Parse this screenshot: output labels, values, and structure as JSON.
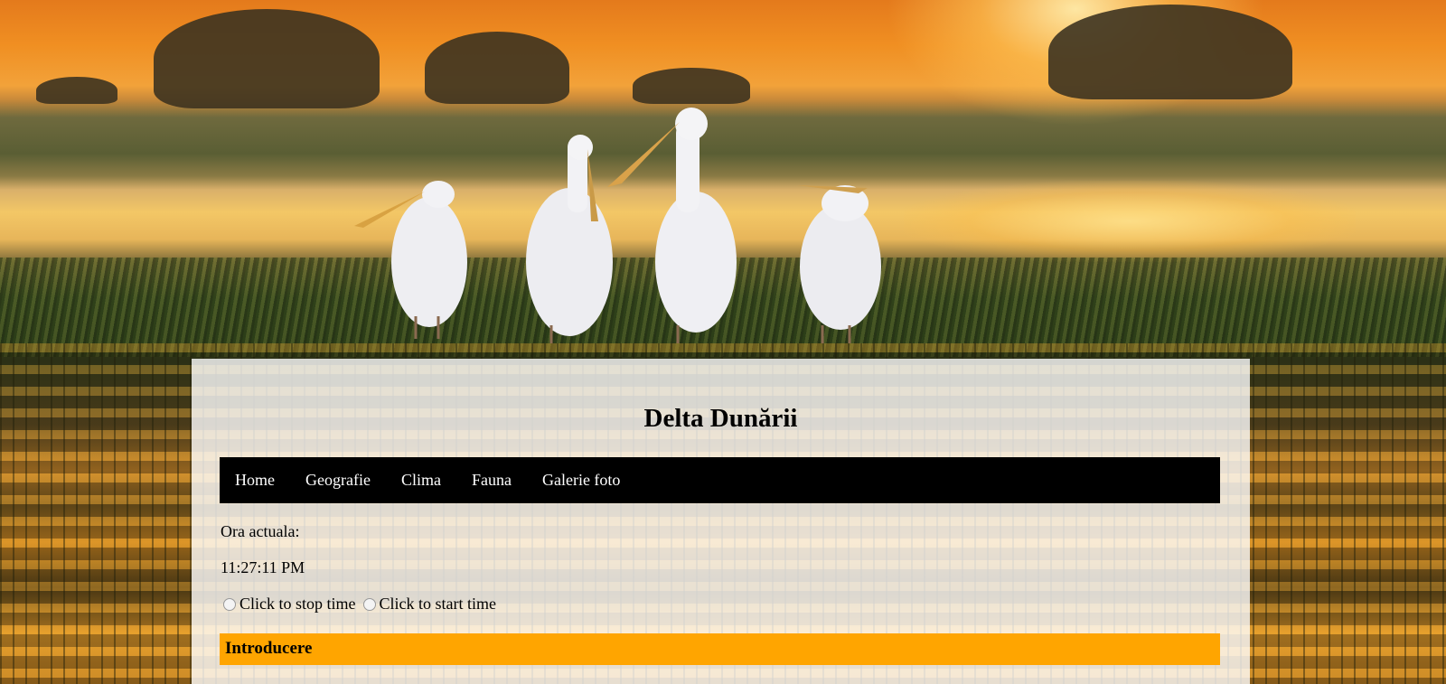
{
  "page": {
    "title": "Delta Dunării"
  },
  "nav": {
    "items": [
      {
        "label": "Home"
      },
      {
        "label": "Geografie"
      },
      {
        "label": "Clima"
      },
      {
        "label": "Fauna"
      },
      {
        "label": "Galerie foto"
      }
    ]
  },
  "clock": {
    "label": "Ora actuala:",
    "time": "11:27:11 PM",
    "stop_label": "Click to stop time",
    "start_label": "Click to start time"
  },
  "sections": [
    {
      "title": "Introducere",
      "color": "#ffa500"
    }
  ],
  "colors": {
    "nav_background": "#000000",
    "nav_text": "#ffffff",
    "section_bar": "#ffa500"
  }
}
